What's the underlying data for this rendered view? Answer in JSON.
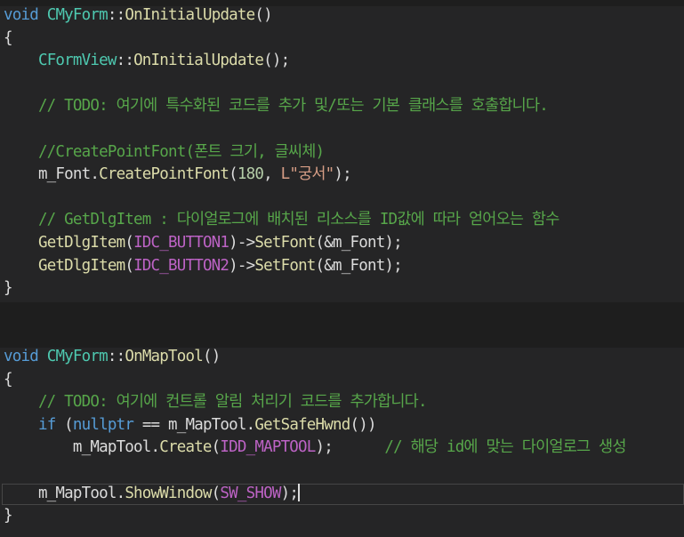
{
  "editor": {
    "theme_colors": {
      "background": "#1e1e1e",
      "block_background": "#252526",
      "keyword": "#569cd6",
      "type": "#4ec9b0",
      "function": "#dcdcaa",
      "comment": "#57a64a",
      "macro": "#bd63c5",
      "string": "#d69d85",
      "number": "#b5cea8",
      "text": "#dcdcdc"
    },
    "lines": [
      [
        {
          "t": "void",
          "c": "kw"
        },
        {
          "t": " ",
          "c": "plain"
        },
        {
          "t": "CMyForm",
          "c": "type"
        },
        {
          "t": "::",
          "c": "plain"
        },
        {
          "t": "OnInitialUpdate",
          "c": "fn"
        },
        {
          "t": "()",
          "c": "plain"
        }
      ],
      [
        {
          "t": "{",
          "c": "plain"
        }
      ],
      [
        {
          "t": "    ",
          "c": "plain"
        },
        {
          "t": "CFormView",
          "c": "type"
        },
        {
          "t": "::",
          "c": "plain"
        },
        {
          "t": "OnInitialUpdate",
          "c": "fn"
        },
        {
          "t": "();",
          "c": "plain"
        }
      ],
      [],
      [
        {
          "t": "    // TODO: 여기에 특수화된 코드를 추가 및/또는 기본 클래스를 호출합니다.",
          "c": "com"
        }
      ],
      [],
      [
        {
          "t": "    //CreatePointFont(폰트 크기, 글씨체)",
          "c": "com"
        }
      ],
      [
        {
          "t": "    m_Font.",
          "c": "plain"
        },
        {
          "t": "CreatePointFont",
          "c": "fn"
        },
        {
          "t": "(",
          "c": "plain"
        },
        {
          "t": "180",
          "c": "num"
        },
        {
          "t": ", ",
          "c": "plain"
        },
        {
          "t": "L\"궁서\"",
          "c": "str"
        },
        {
          "t": ");",
          "c": "plain"
        }
      ],
      [],
      [
        {
          "t": "    // GetDlgItem : 다이얼로그에 배치된 리소스를 ID값에 따라 얻어오는 함수",
          "c": "com"
        }
      ],
      [
        {
          "t": "    ",
          "c": "plain"
        },
        {
          "t": "GetDlgItem",
          "c": "fn"
        },
        {
          "t": "(",
          "c": "plain"
        },
        {
          "t": "IDC_BUTTON1",
          "c": "macro"
        },
        {
          "t": ")->",
          "c": "plain"
        },
        {
          "t": "SetFont",
          "c": "fn"
        },
        {
          "t": "(&m_Font);",
          "c": "plain"
        }
      ],
      [
        {
          "t": "    ",
          "c": "plain"
        },
        {
          "t": "GetDlgItem",
          "c": "fn"
        },
        {
          "t": "(",
          "c": "plain"
        },
        {
          "t": "IDC_BUTTON2",
          "c": "macro"
        },
        {
          "t": ")->",
          "c": "plain"
        },
        {
          "t": "SetFont",
          "c": "fn"
        },
        {
          "t": "(&m_Font);",
          "c": "plain"
        }
      ],
      [
        {
          "t": "}",
          "c": "plain"
        }
      ],
      [],
      [],
      [
        {
          "t": "void",
          "c": "kw"
        },
        {
          "t": " ",
          "c": "plain"
        },
        {
          "t": "CMyForm",
          "c": "type"
        },
        {
          "t": "::",
          "c": "plain"
        },
        {
          "t": "OnMapTool",
          "c": "fn"
        },
        {
          "t": "()",
          "c": "plain"
        }
      ],
      [
        {
          "t": "{",
          "c": "plain"
        }
      ],
      [
        {
          "t": "    // TODO: 여기에 컨트롤 알림 처리기 코드를 추가합니다.",
          "c": "com"
        }
      ],
      [
        {
          "t": "    ",
          "c": "plain"
        },
        {
          "t": "if",
          "c": "kw"
        },
        {
          "t": " (",
          "c": "plain"
        },
        {
          "t": "nullptr",
          "c": "kw"
        },
        {
          "t": " == m_MapTool.",
          "c": "plain"
        },
        {
          "t": "GetSafeHwnd",
          "c": "fn"
        },
        {
          "t": "())",
          "c": "plain"
        }
      ],
      [
        {
          "t": "        m_MapTool.",
          "c": "plain"
        },
        {
          "t": "Create",
          "c": "fn"
        },
        {
          "t": "(",
          "c": "plain"
        },
        {
          "t": "IDD_MAPTOOL",
          "c": "macro"
        },
        {
          "t": ");      ",
          "c": "plain"
        },
        {
          "t": "// 해당 id에 맞는 다이얼로그 생성",
          "c": "com"
        }
      ],
      [],
      [
        {
          "t": "    m_MapTool.",
          "c": "plain"
        },
        {
          "t": "ShowWindow",
          "c": "fn"
        },
        {
          "t": "(",
          "c": "plain"
        },
        {
          "t": "SW_SHOW",
          "c": "macro"
        },
        {
          "t": ");",
          "c": "plain"
        },
        {
          "caret": true
        }
      ],
      [
        {
          "t": "}",
          "c": "plain"
        }
      ]
    ],
    "current_line": 21
  }
}
